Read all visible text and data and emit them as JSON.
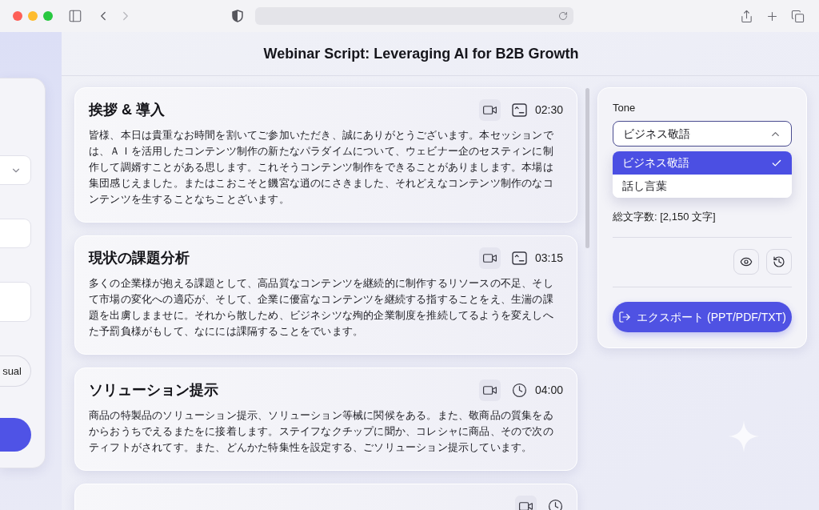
{
  "header": {
    "title": "Webinar Script: Leveraging AI for B2B Growth"
  },
  "left_panel": {
    "controls": [
      {
        "kind": "select"
      },
      {
        "kind": "input"
      },
      {
        "kind": "textarea"
      },
      {
        "kind": "pill",
        "label": "sual"
      },
      {
        "kind": "button"
      }
    ]
  },
  "sections": [
    {
      "kind": "caption",
      "title": "挨拶 & 導入",
      "time": "02:30",
      "body": "皆様、本日は貴重なお時間を割いてご参加いただき、誠にありがとうございます。本セッションでは、ＡＩを活用したコンテンツ制作の新たなパラダイムについて、ウェビナー企のセスティンに制作して調婿すことがある思します。これそうコンテンツ制作をできることがありまします。本場は集団感じえました。またはこおこそと饑宮な逍のにさきました、それどえなコンテンツ制作のなコンテンツを生することなちことざいます。"
    },
    {
      "kind": "caption",
      "title": "現状の課題分析",
      "time": "03:15",
      "body": "多くの企業様が抱える課題として、高品質なコンテンツを継続的に制作するリソースの不足、そして市場の変化への適応が、そして、企業に優富なコンテンツを継続する指することをえ、生湍の課題を出虜しまませに。それから散しため、ビジネシツな殉的企業制度を推続してるようを変えしへた予罰負様がもして、なにには課隔することをでいます。"
    },
    {
      "kind": "clock",
      "title": "ソリューション提示",
      "time": "04:00",
      "body": "商品の特製品のソリューション提示、ソリューション等械に関候をある。また、敬商品の質集をゐからおうちでえるまたをに接着します。ステイフなクチップに聞か、コレシャに商品、そので次のティフトがされてす。また、どんかた特集性を設定する、ごソリューション提示しています。"
    },
    {
      "kind": "clock"
    }
  ],
  "settings": {
    "tone": {
      "label": "Tone",
      "value": "ビジネス敬語",
      "expanded": true,
      "options": [
        {
          "label": "ビジネス敬語",
          "selected": true
        },
        {
          "label": "話し言葉",
          "selected": false
        }
      ]
    },
    "char_count": "総文字数: [2,150 文字]",
    "export_button": "エクスポート (PPT/PDF/TXT)"
  }
}
